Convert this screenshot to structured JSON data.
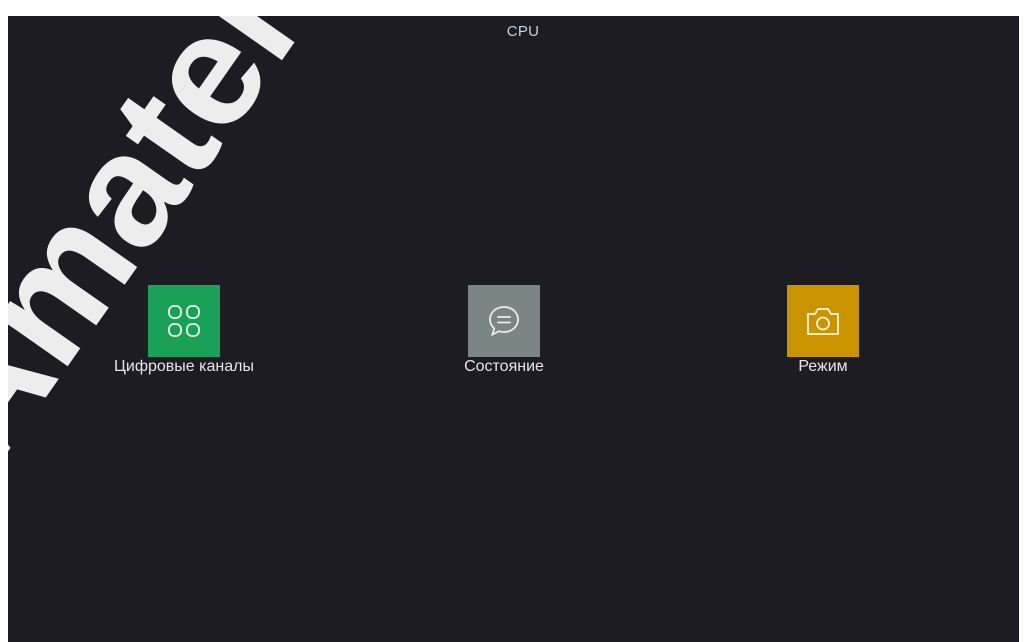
{
  "header": {
    "title": "CPU"
  },
  "menu": {
    "items": [
      {
        "label": "Цифровые каналы",
        "icon": "grid-icon",
        "color": "#1aa157"
      },
      {
        "label": "Состояние",
        "icon": "chat-bubble-icon",
        "color": "#7c8586"
      },
      {
        "label": "Режим",
        "icon": "camera-icon",
        "color": "#c99400"
      }
    ]
  },
  "watermark": {
    "text": "Amatel"
  },
  "colors": {
    "screen_bg": "#1d1c22",
    "text": "#e6e6ea",
    "title_text": "#c9d0de"
  }
}
